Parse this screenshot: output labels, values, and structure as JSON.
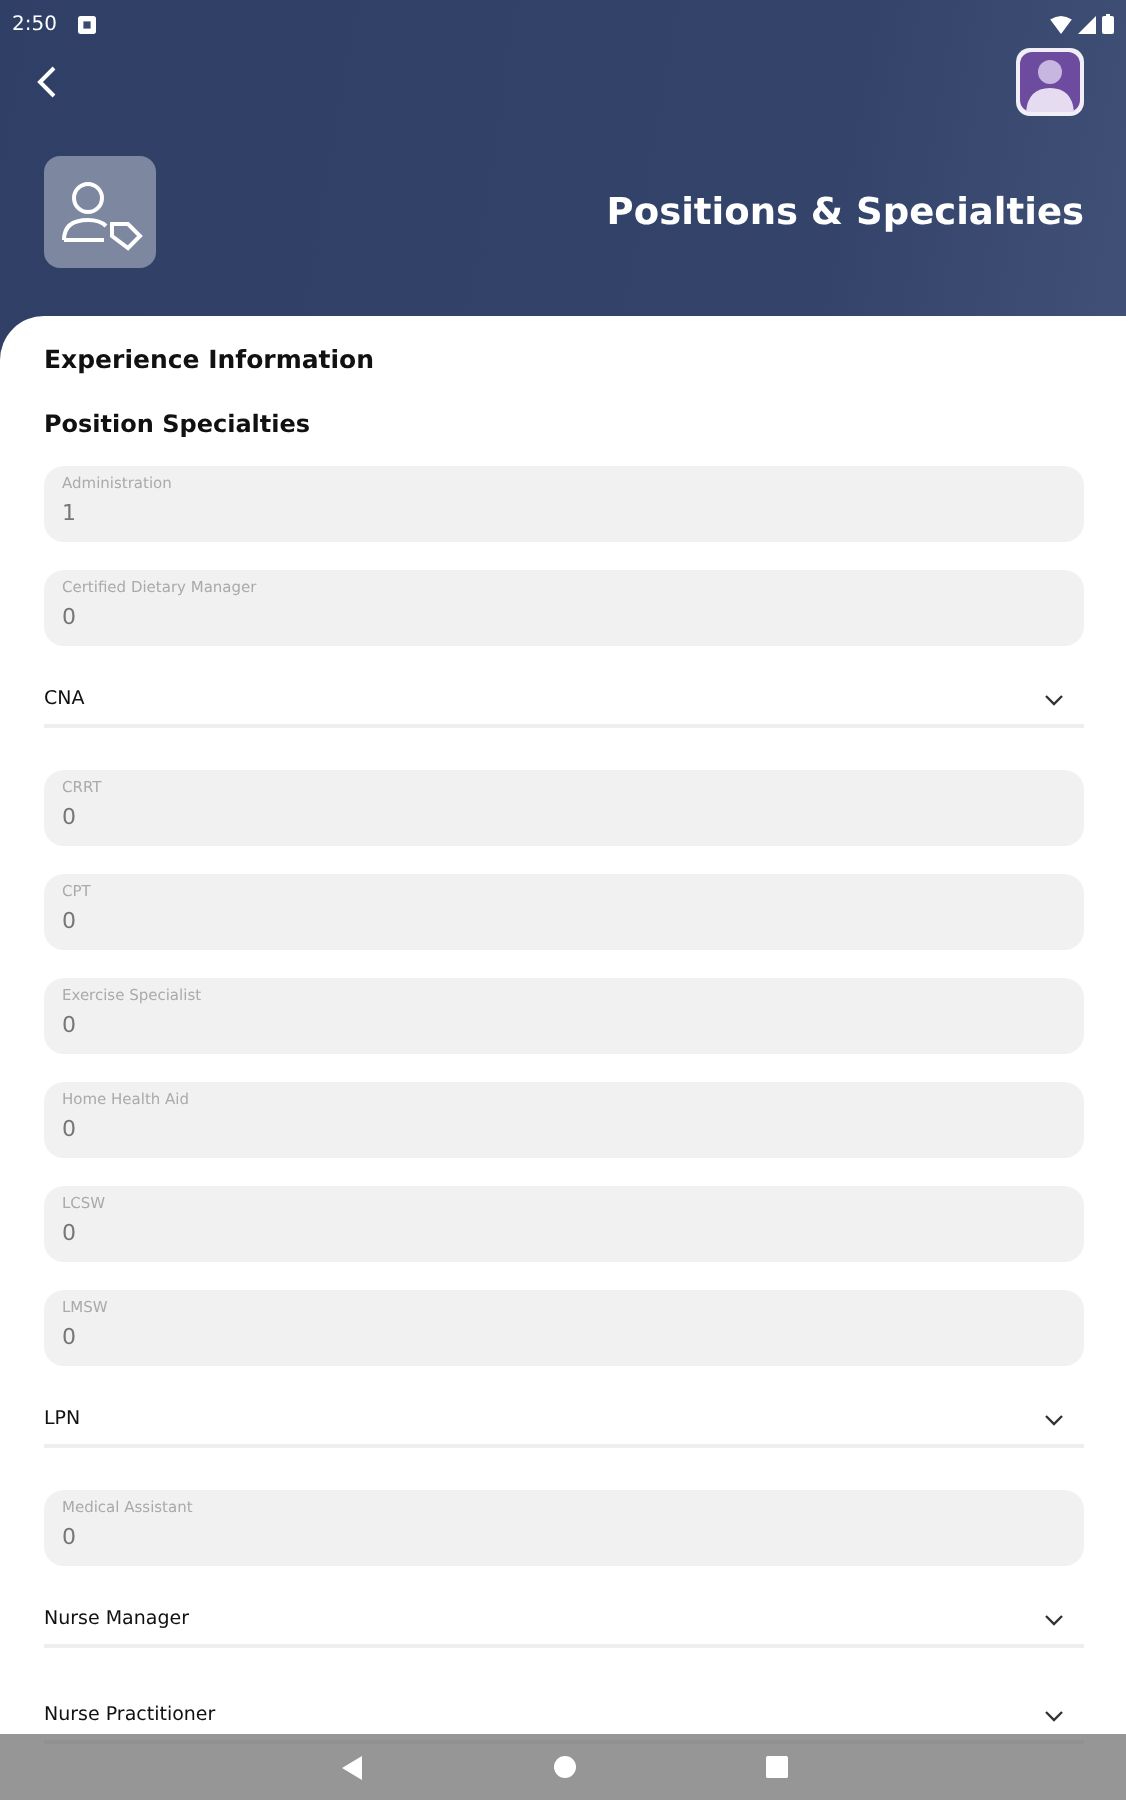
{
  "status_bar": {
    "time": "2:50"
  },
  "header": {
    "title": "Positions & Specialties"
  },
  "card": {
    "section_title": "Experience Information",
    "subsection_title": "Position Specialties"
  },
  "items": [
    {
      "kind": "field",
      "label": "Administration",
      "value": "1"
    },
    {
      "kind": "field",
      "label": "Certified Dietary Manager",
      "value": "0"
    },
    {
      "kind": "dropdown",
      "label": "CNA",
      "expanded": false
    },
    {
      "kind": "field",
      "label": "CRRT",
      "value": "0"
    },
    {
      "kind": "field",
      "label": "CPT",
      "value": "0"
    },
    {
      "kind": "field",
      "label": "Exercise Specialist",
      "value": "0"
    },
    {
      "kind": "field",
      "label": "Home Health Aid",
      "value": "0"
    },
    {
      "kind": "field",
      "label": "LCSW",
      "value": "0"
    },
    {
      "kind": "field",
      "label": "LMSW",
      "value": "0"
    },
    {
      "kind": "dropdown",
      "label": "LPN",
      "expanded": false
    },
    {
      "kind": "field",
      "label": "Medical Assistant",
      "value": "0"
    },
    {
      "kind": "dropdown",
      "label": "Nurse Manager",
      "expanded": false
    },
    {
      "kind": "dropdown",
      "label": "Nurse Practitioner",
      "expanded": false
    }
  ]
}
